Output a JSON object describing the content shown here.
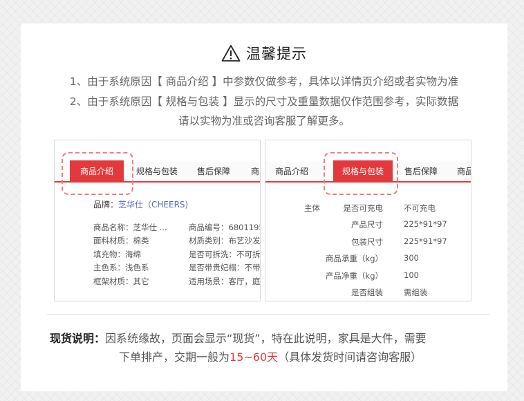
{
  "title": "温馨提示",
  "notices": [
    "1、由于系统原因【 商品介绍 】中参数仅做参考，具体以详情页介绍或者实物为准",
    "2、由于系统原因【 规格与包装 】显示的尺寸及重量数据仅作范围参考，实际数据",
    "请以实物为准或咨询客服了解更多。"
  ],
  "panel1": {
    "tabs": [
      "商品介绍",
      "规格与包装",
      "售后保障",
      "商品"
    ],
    "brand_label": "品牌：",
    "brand_value": "芝华仕（CHEERS)",
    "attrs_left": [
      "商品名称：芝华仕 ...",
      "面料材质：棉类",
      "填充物：海绵",
      "主色系：浅色系",
      "框架材质：其它"
    ],
    "attrs_right": [
      "商品编号：6801195...",
      "材质类别：布艺沙发",
      "是否可拆洗：不可拆洗",
      "是否带贵妃榻：不带...",
      "适用场景：客厅，庭..."
    ]
  },
  "panel2": {
    "tabs": [
      "商品介绍",
      "规格与包装",
      "售后保障",
      "商品"
    ],
    "group": "主体",
    "specs": [
      {
        "label": "是否可充电",
        "value": "不可充电"
      },
      {
        "label": "产品尺寸",
        "value": "225*91*97"
      },
      {
        "label": "包装尺寸",
        "value": "225*91*97"
      },
      {
        "label": "商品承重（kg）",
        "value": "300"
      },
      {
        "label": "产品净重（kg）",
        "value": "100"
      },
      {
        "label": "是否组装",
        "value": "需组装"
      }
    ]
  },
  "stock": {
    "label": "现货说明：",
    "line1": "因系统缘故，页面会显示“现货”，特在此说明，家具是大件，需要",
    "line2_pre": "下单排产，交期一般为",
    "line2_highlight": "15~60天",
    "line2_post": "（具体发货时间请咨询客服）"
  },
  "colors": {
    "accent": "#e4393c",
    "dashed": "#f07c80",
    "brand_link": "#5b6ab3"
  }
}
